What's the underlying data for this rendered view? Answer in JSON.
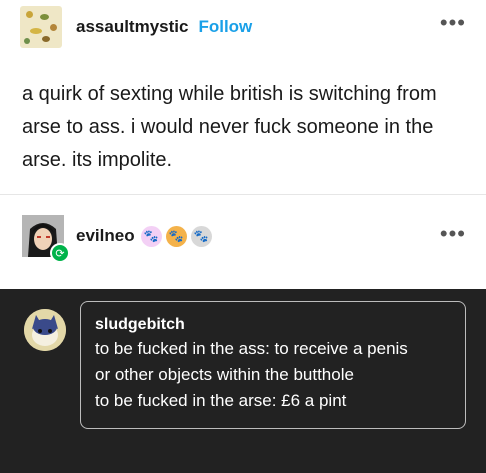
{
  "original_post": {
    "username": "assaultmystic",
    "follow_label": "Follow",
    "more_icon": "ellipsis-icon",
    "text": "a quirk of sexting while british is switching from arse to ass. i would never fuck someone in the arse. its impolite."
  },
  "reblog": {
    "username": "evilneo",
    "reblog_icon": "reblog-icon",
    "badges": [
      "paw-icon",
      "paw-icon",
      "paw-icon"
    ],
    "more_icon": "ellipsis-icon"
  },
  "quote": {
    "username": "sludgebitch",
    "lines": [
      "to be fucked in the ass: to receive a penis",
      "or other objects within the butthole",
      "to be fucked in the arse: £6 a pint"
    ]
  },
  "colors": {
    "follow": "#1aa0e8",
    "dark_panel": "#222222",
    "reblog_badge": "#00b34a"
  }
}
